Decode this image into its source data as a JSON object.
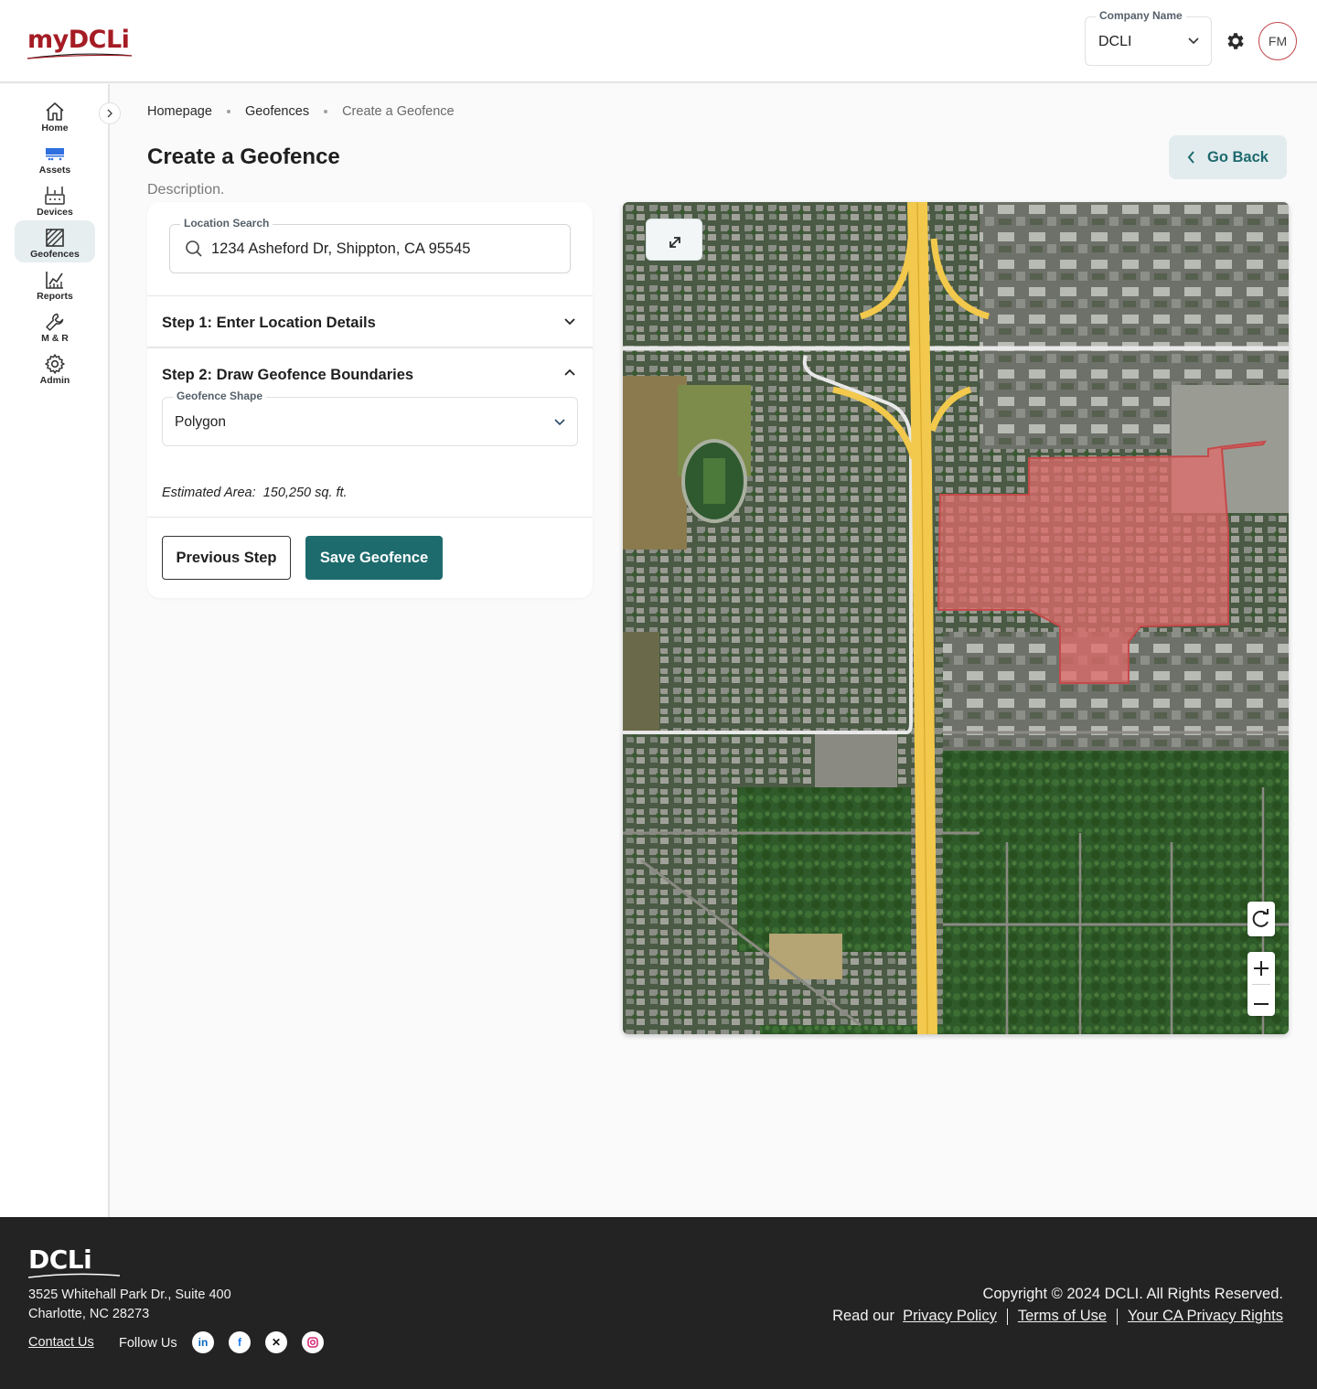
{
  "header": {
    "logo_prefix": "my",
    "logo_brand": "DCLi",
    "company_label": "Company Name",
    "company_value": "DCLI",
    "avatar_initials": "FM"
  },
  "sidebar": {
    "items": [
      {
        "label": "Home",
        "icon": "home-icon"
      },
      {
        "label": "Assets",
        "icon": "assets-icon"
      },
      {
        "label": "Devices",
        "icon": "devices-icon"
      },
      {
        "label": "Geofences",
        "icon": "geofence-icon",
        "active": true
      },
      {
        "label": "Reports",
        "icon": "reports-icon"
      },
      {
        "label": "M & R",
        "icon": "wrench-icon"
      },
      {
        "label": "Admin",
        "icon": "admin-gear-icon"
      }
    ]
  },
  "breadcrumb": [
    "Homepage",
    "Geofences",
    "Create a Geofence"
  ],
  "page": {
    "title": "Create a Geofence",
    "description": "Description.",
    "go_back": "Go Back"
  },
  "form": {
    "location_label": "Location Search",
    "location_value": "1234 Asheford Dr, Shippton, CA 95545",
    "step1": "Step 1: Enter Location Details",
    "step2": "Step 2: Draw Geofence Boundaries",
    "shape_label": "Geofence Shape",
    "shape_value": "Polygon",
    "estimated_area_label": "Estimated Area:",
    "estimated_area_value": "150,250 sq. ft.",
    "prev_button": "Previous Step",
    "save_button": "Save Geofence"
  },
  "colors": {
    "accent": "#1d6b6d",
    "brand_red": "#a51c24",
    "geofence_fill": "#e06b6b",
    "highway": "#f2c94c"
  },
  "footer": {
    "brand": "DCLi",
    "address_line1": "3525 Whitehall Park Dr., Suite 400",
    "address_line2": "Charlotte, NC 28273",
    "contact": "Contact Us",
    "follow": "Follow Us",
    "copyright": "Copyright © 2024 DCLI. All Rights Reserved.",
    "read_our": "Read our",
    "privacy": "Privacy Policy",
    "terms": "Terms of Use",
    "ca_privacy": "Your CA Privacy Rights",
    "socials": [
      "linkedin-icon",
      "facebook-icon",
      "x-icon",
      "instagram-icon"
    ]
  }
}
